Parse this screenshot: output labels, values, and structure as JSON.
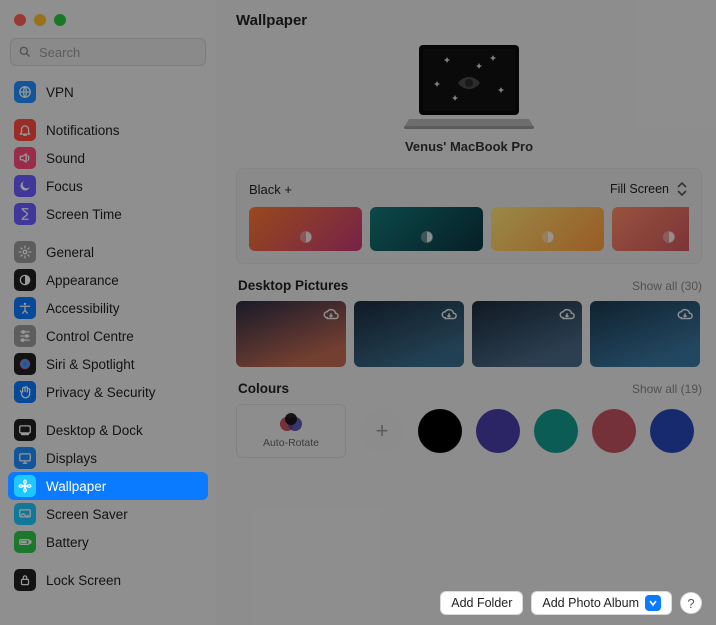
{
  "window": {
    "search_placeholder": "Search"
  },
  "title": "Wallpaper",
  "sidebar": {
    "items": [
      {
        "id": "vpn",
        "label": "VPN",
        "icon": "globe-icon",
        "bg": "#1e8fff",
        "fg": "#fff"
      },
      {
        "id": "notifications",
        "label": "Notifications",
        "icon": "bell-icon",
        "bg": "#ff4b3e",
        "fg": "#fff"
      },
      {
        "id": "sound",
        "label": "Sound",
        "icon": "speaker-icon",
        "bg": "#ff4b7a",
        "fg": "#fff"
      },
      {
        "id": "focus",
        "label": "Focus",
        "icon": "moon-icon",
        "bg": "#6a5cff",
        "fg": "#fff"
      },
      {
        "id": "screen-time",
        "label": "Screen Time",
        "icon": "hourglass-icon",
        "bg": "#6a5cff",
        "fg": "#fff"
      },
      {
        "id": "general",
        "label": "General",
        "icon": "gear-icon",
        "bg": "#9c9c9c",
        "fg": "#fff"
      },
      {
        "id": "appearance",
        "label": "Appearance",
        "icon": "appearance-icon",
        "bg": "#202020",
        "fg": "#fff"
      },
      {
        "id": "accessibility",
        "label": "Accessibility",
        "icon": "accessibility-icon",
        "bg": "#0a7aff",
        "fg": "#fff"
      },
      {
        "id": "control-centre",
        "label": "Control Centre",
        "icon": "sliders-icon",
        "bg": "#9c9c9c",
        "fg": "#fff"
      },
      {
        "id": "siri-spotlight",
        "label": "Siri & Spotlight",
        "icon": "siri-icon",
        "bg": "#202020",
        "fg": "#fff"
      },
      {
        "id": "privacy-security",
        "label": "Privacy & Security",
        "icon": "hand-icon",
        "bg": "#0a7aff",
        "fg": "#fff"
      },
      {
        "id": "desktop-dock",
        "label": "Desktop & Dock",
        "icon": "dock-icon",
        "bg": "#202020",
        "fg": "#fff"
      },
      {
        "id": "displays",
        "label": "Displays",
        "icon": "display-icon",
        "bg": "#1e8fff",
        "fg": "#fff"
      },
      {
        "id": "wallpaper",
        "label": "Wallpaper",
        "icon": "flower-icon",
        "bg": "#1ec8ff",
        "fg": "#fff",
        "selected": true
      },
      {
        "id": "screen-saver",
        "label": "Screen Saver",
        "icon": "screensaver-icon",
        "bg": "#1ec8ff",
        "fg": "#fff"
      },
      {
        "id": "battery",
        "label": "Battery",
        "icon": "battery-icon",
        "bg": "#2ec94a",
        "fg": "#fff"
      },
      {
        "id": "lock-screen",
        "label": "Lock Screen",
        "icon": "lock-icon",
        "bg": "#202020",
        "fg": "#fff"
      }
    ],
    "spacers_after": [
      "vpn",
      "screen-time",
      "privacy-security",
      "battery"
    ]
  },
  "preview": {
    "device_name": "Venus' MacBook Pro"
  },
  "current_wallpaper": {
    "label": "Black +",
    "fit_option": "Fill Screen",
    "thumbs": [
      {
        "id": "dyn-1",
        "gradient": "linear-gradient(135deg,#ff7a2f,#c5397a)"
      },
      {
        "id": "dyn-2",
        "gradient": "linear-gradient(135deg,#147a79,#0b3440)"
      },
      {
        "id": "dyn-3",
        "gradient": "linear-gradient(135deg,#ffe477,#ff9a3f)"
      },
      {
        "id": "dyn-4",
        "gradient": "linear-gradient(135deg,#ff8a66,#c0495d)"
      }
    ]
  },
  "desktop_pictures": {
    "title": "Desktop Pictures",
    "show_all_label": "Show all",
    "count": 30,
    "thumbs": [
      {
        "id": "dp-1",
        "bg": "linear-gradient(160deg,#2b2b46,#c06a52 80%)"
      },
      {
        "id": "dp-2",
        "bg": "linear-gradient(160deg,#1b2c3c,#3a6b8a 80%)"
      },
      {
        "id": "dp-3",
        "bg": "linear-gradient(160deg,#1a2a3a,#4a6a88 80%)"
      },
      {
        "id": "dp-4",
        "bg": "linear-gradient(160deg,#1a3950,#3a77a0 80%)"
      }
    ]
  },
  "colours": {
    "title": "Colours",
    "show_all_label": "Show all",
    "count": 19,
    "auto_rotate_label": "Auto-Rotate",
    "swatches": [
      {
        "id": "c-black",
        "hex": "#000000"
      },
      {
        "id": "c-indigo",
        "hex": "#4a3fa8"
      },
      {
        "id": "c-teal",
        "hex": "#149a8f"
      },
      {
        "id": "c-rose",
        "hex": "#c35362"
      },
      {
        "id": "c-blue",
        "hex": "#2846b8"
      }
    ]
  },
  "footer": {
    "add_folder_label": "Add Folder",
    "add_album_label": "Add Photo Album",
    "help_label": "?"
  }
}
